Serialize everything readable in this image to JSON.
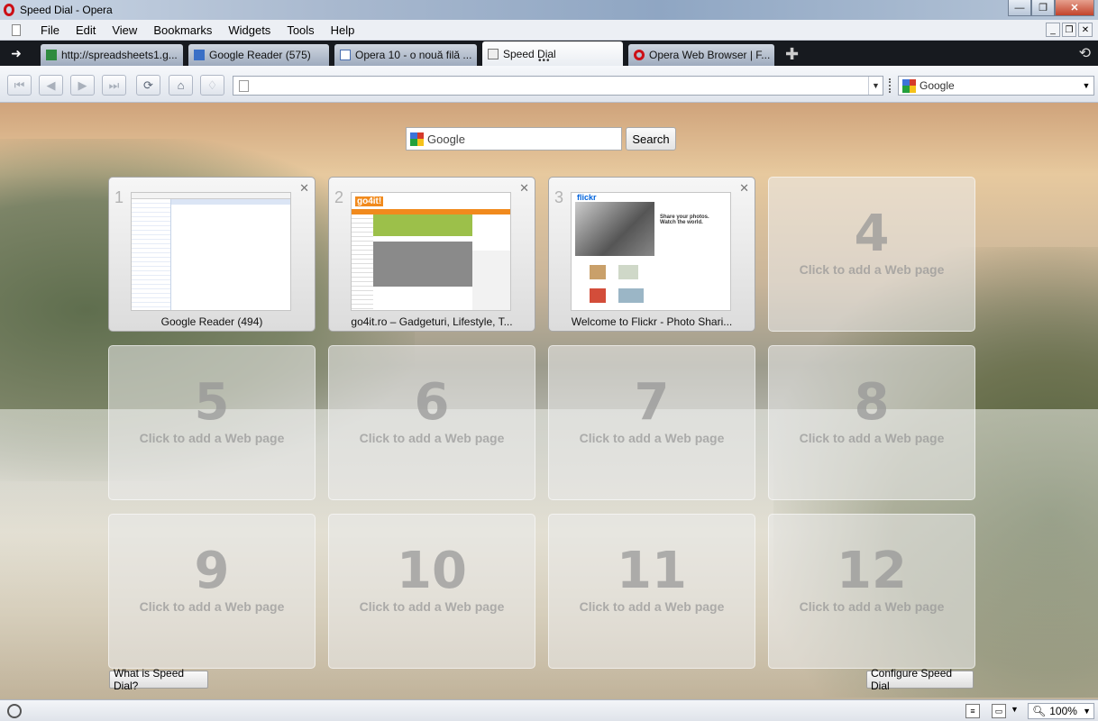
{
  "window": {
    "title": "Speed Dial - Opera",
    "minimize": "—",
    "maximize": "❐",
    "close": "✕"
  },
  "menu": [
    "File",
    "Edit",
    "View",
    "Bookmarks",
    "Widgets",
    "Tools",
    "Help"
  ],
  "mdi_controls": {
    "minimize": "_",
    "restore": "❐",
    "close": "✕"
  },
  "tabs": [
    {
      "label": "http://spreadsheets1.g...",
      "icon": "spreadsheet-icon"
    },
    {
      "label": "Google Reader (575)",
      "icon": "feed-icon"
    },
    {
      "label": "Opera 10 - o nouă filă ...",
      "icon": "page-icon"
    },
    {
      "label": "Speed Dial",
      "icon": "speed-dial-icon",
      "active": true
    },
    {
      "label": "Opera Web Browser | F...",
      "icon": "opera-icon"
    }
  ],
  "toolbar": {
    "address_value": "",
    "search_engine": "Google"
  },
  "speed_dial": {
    "search_placeholder": "Google",
    "search_button": "Search",
    "empty_label": "Click to add a Web page",
    "dials": [
      {
        "number": "1",
        "title": "Google Reader (494)",
        "filled": true
      },
      {
        "number": "2",
        "title": "go4it.ro – Gadgeturi, Lifestyle, T...",
        "filled": true
      },
      {
        "number": "3",
        "title": "Welcome to Flickr - Photo Shari...",
        "filled": true
      },
      {
        "number": "4",
        "filled": false
      },
      {
        "number": "5",
        "filled": false
      },
      {
        "number": "6",
        "filled": false
      },
      {
        "number": "7",
        "filled": false
      },
      {
        "number": "8",
        "filled": false
      },
      {
        "number": "9",
        "filled": false
      },
      {
        "number": "10",
        "filled": false
      },
      {
        "number": "11",
        "filled": false
      },
      {
        "number": "12",
        "filled": false
      }
    ],
    "what_is": "What is Speed Dial?",
    "configure": "Configure Speed Dial"
  },
  "thumbs": {
    "go4it_logo": "go4it!",
    "flickr_logo": "flickr",
    "flickr_tagline": "Share your photos. Watch the world."
  },
  "status": {
    "zoom": "100%"
  }
}
